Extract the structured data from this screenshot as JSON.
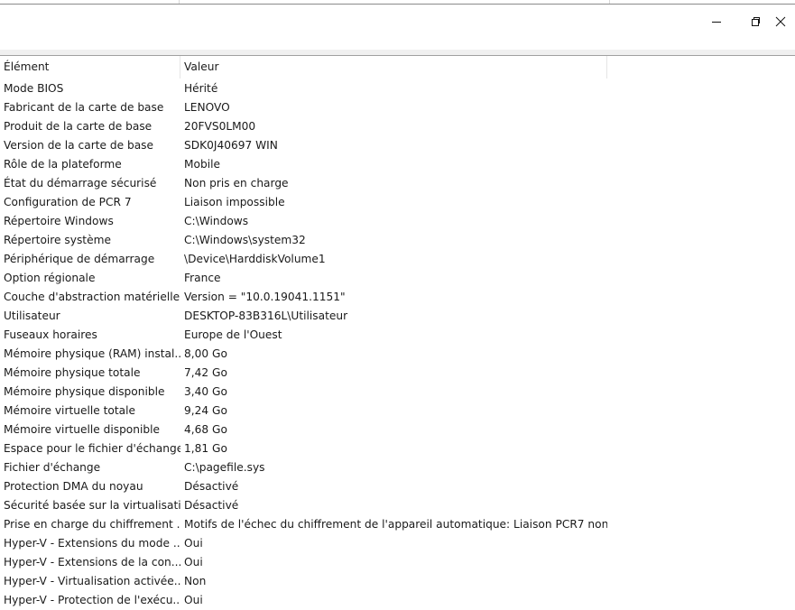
{
  "window": {
    "caption_buttons": {
      "minimize_icon": "minimize-icon",
      "maximize_icon": "restore-icon",
      "close_icon": "close-icon"
    }
  },
  "table": {
    "columns": [
      "Élément",
      "Valeur"
    ],
    "rows": [
      [
        "Mode BIOS",
        "Hérité"
      ],
      [
        "Fabricant de la carte de base",
        "LENOVO"
      ],
      [
        "Produit de la carte de base",
        "20FVS0LM00"
      ],
      [
        "Version de la carte de base",
        "SDK0J40697 WIN"
      ],
      [
        "Rôle de la plateforme",
        "Mobile"
      ],
      [
        "État du démarrage sécurisé",
        "Non pris en charge"
      ],
      [
        "Configuration de PCR 7",
        "Liaison impossible"
      ],
      [
        "Répertoire Windows",
        "C:\\Windows"
      ],
      [
        "Répertoire système",
        "C:\\Windows\\system32"
      ],
      [
        "Périphérique de démarrage",
        "\\Device\\HarddiskVolume1"
      ],
      [
        "Option régionale",
        "France"
      ],
      [
        "Couche d'abstraction matérielle",
        "Version = \"10.0.19041.1151\""
      ],
      [
        "Utilisateur",
        "DESKTOP-83B316L\\Utilisateur"
      ],
      [
        "Fuseaux horaires",
        "Europe de l'Ouest"
      ],
      [
        "Mémoire physique (RAM) instal...",
        "8,00 Go"
      ],
      [
        "Mémoire physique totale",
        "7,42 Go"
      ],
      [
        "Mémoire physique disponible",
        "3,40 Go"
      ],
      [
        "Mémoire virtuelle totale",
        "9,24 Go"
      ],
      [
        "Mémoire virtuelle disponible",
        "4,68 Go"
      ],
      [
        "Espace pour le fichier d'échange",
        "1,81 Go"
      ],
      [
        "Fichier d'échange",
        "C:\\pagefile.sys"
      ],
      [
        "Protection DMA du noyau",
        "Désactivé"
      ],
      [
        "Sécurité basée sur la virtualisati...",
        "Désactivé"
      ],
      [
        "Prise en charge du chiffrement ...",
        "Motifs de l'échec du chiffrement de l'appareil automatique: Liaison PCR7 non ..."
      ],
      [
        "Hyper-V - Extensions du mode ...",
        "Oui"
      ],
      [
        "Hyper-V - Extensions de la con...",
        "Oui"
      ],
      [
        "Hyper-V - Virtualisation activée...",
        "Non"
      ],
      [
        "Hyper-V - Protection de l'exécu...",
        "Oui"
      ]
    ]
  }
}
